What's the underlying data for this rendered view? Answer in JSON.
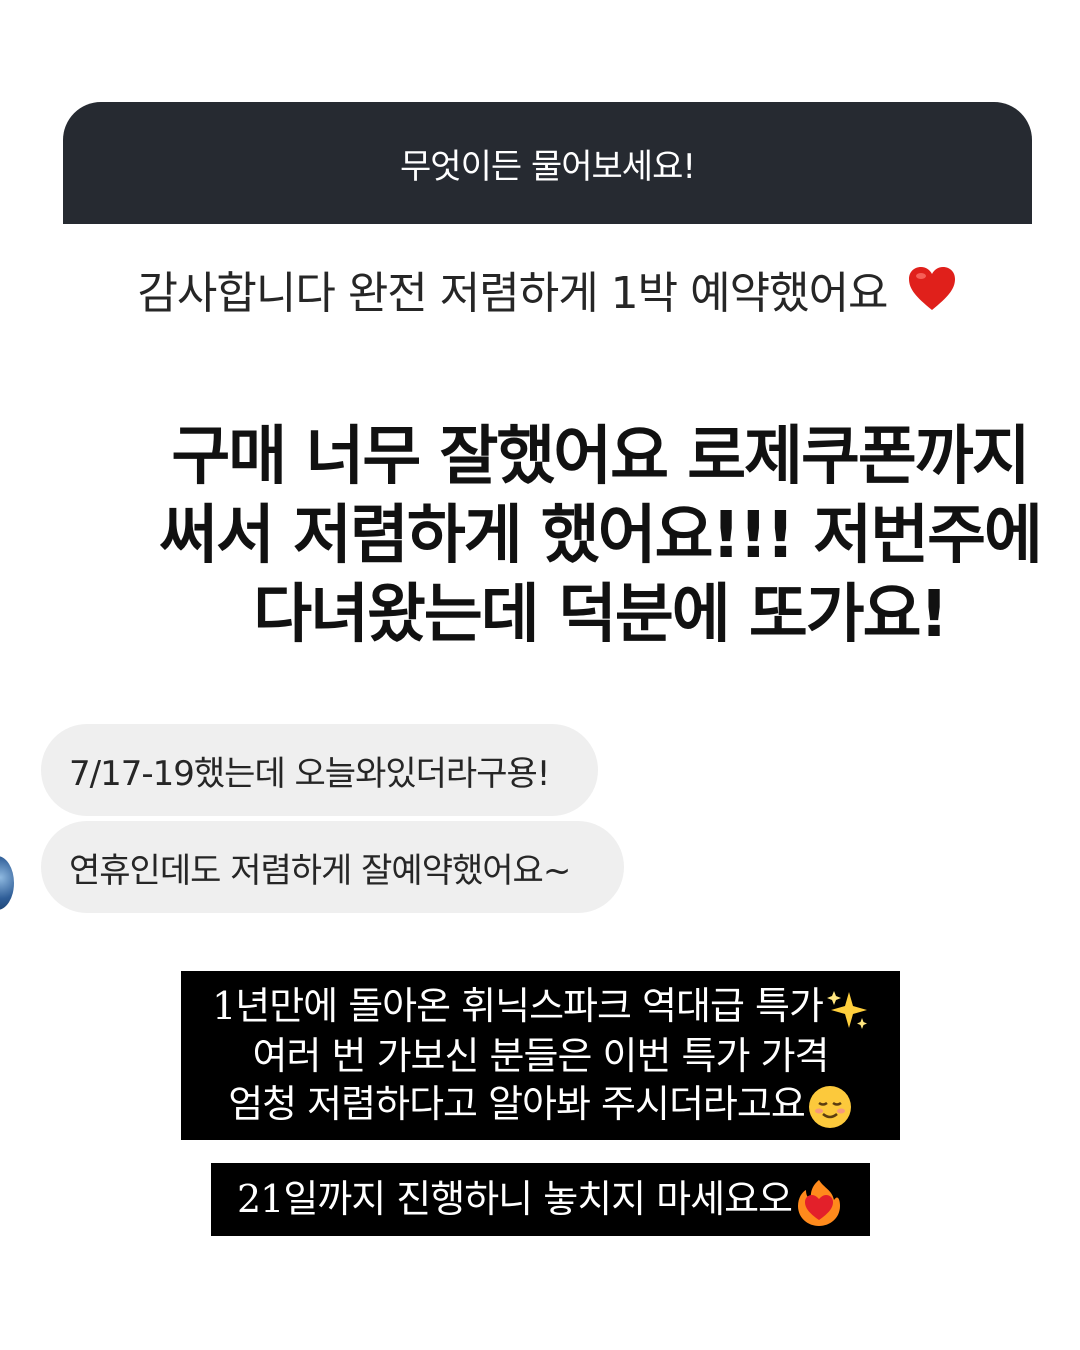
{
  "question_sticker": {
    "prompt": "무엇이든 물어보세요!",
    "answer": "감사합니다 완전 저렴하게 1박 예약했어요",
    "answer_emoji": "heart-icon",
    "header_color": "#262a31"
  },
  "reply": {
    "line1": "구매 너무 잘했어요 로제쿠폰까지",
    "line2": "써서 저렴하게 했어요!!! 저번주에",
    "line3": "다녀왔는데 덕분에 또가요!"
  },
  "dm": {
    "messages": [
      {
        "text": "7/17-19했는데 오늘와있더라구용!"
      },
      {
        "text": "연휴인데도 저렴하게 잘예약했어요~"
      }
    ],
    "bubble_color": "#efefef"
  },
  "captions": {
    "box1": {
      "line1": "1년만에 돌아온 휘닉스파크 역대급 특가",
      "line1_emoji": "sparkles-icon",
      "line2": "여러 번 가보신 분들은 이번 특가 가격",
      "line3": "엄청 저렴하다고 알아봐 주시더라고요",
      "line3_emoji": "smiling-face-icon"
    },
    "box2": {
      "text": "21일까지 진행하니 놓치지 마세요오",
      "emoji": "heart-on-fire-icon"
    }
  }
}
